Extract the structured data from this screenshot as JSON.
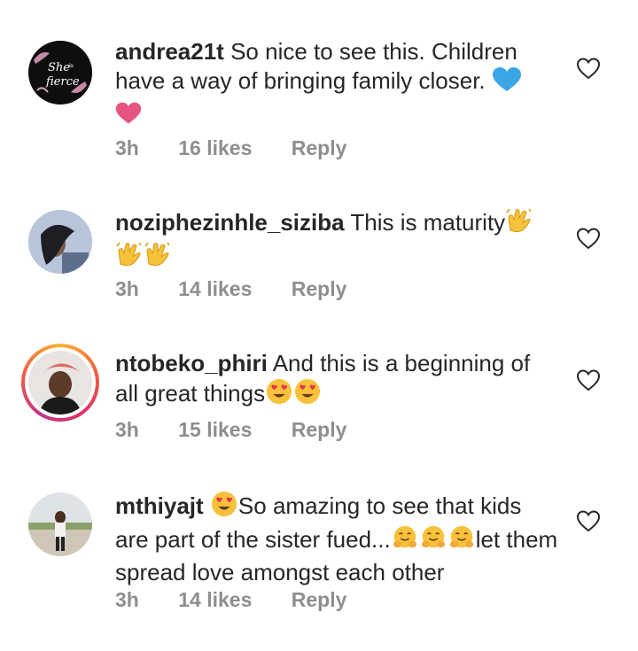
{
  "comments": [
    {
      "username": "andrea21t",
      "text": "So nice to see this. Children have a way of bringing family closer.",
      "time": "3h",
      "likes": "16 likes",
      "reply": "Reply",
      "emojis": [
        "blue-heart",
        "pink-heart"
      ]
    },
    {
      "username": "noziphezinhle_siziba",
      "text": "This is maturity",
      "time": "3h",
      "likes": "14 likes",
      "reply": "Reply",
      "emojis": [
        "clapping-hands",
        "clapping-hands",
        "clapping-hands"
      ]
    },
    {
      "username": "ntobeko_phiri",
      "text": "And this is a beginning of all great things",
      "time": "3h",
      "likes": "15 likes",
      "reply": "Reply",
      "emojis": [
        "heart-eyes-face",
        "heart-eyes-face"
      ]
    },
    {
      "username": "mthiyajt",
      "text_part1": "So amazing to see that kids are part of the sister fued...",
      "text_part2": "let them spread love amongst each other",
      "time": "3h",
      "likes": "14 likes",
      "reply": "Reply",
      "emojis": [
        "heart-eyes-face",
        "hugging-face",
        "hugging-face",
        "hugging-face"
      ]
    }
  ],
  "avatar1_lettering": "She is fierce",
  "colors": {
    "text": "#262626",
    "meta": "#8e8e8e",
    "blue_heart": "#3aa6e6",
    "pink_heart": "#e75480"
  }
}
